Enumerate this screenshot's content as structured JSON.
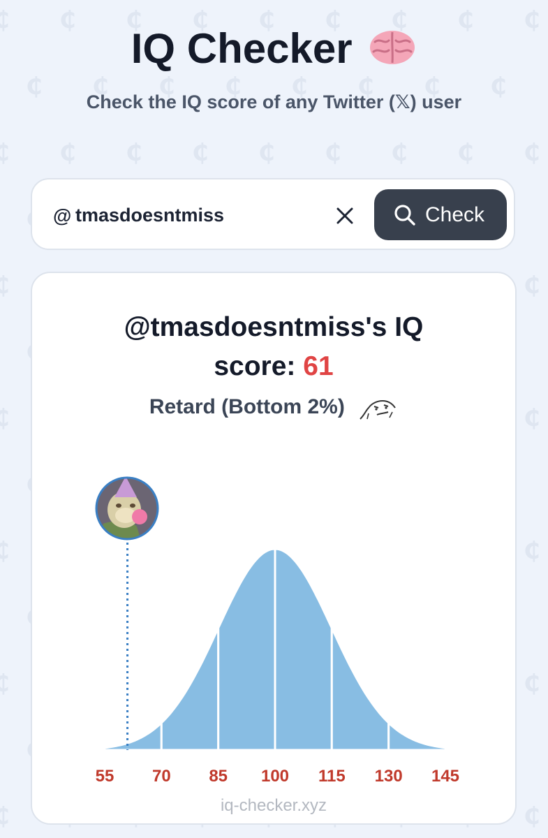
{
  "header": {
    "title": "IQ Checker",
    "brain_icon": "brain-emoji",
    "subtitle": "Check the IQ score of any Twitter (𝕏) user"
  },
  "search": {
    "at_sign": "@",
    "value": "tmasdoesntmiss",
    "clear_icon": "close-icon",
    "button_icon": "search-icon",
    "button_label": "Check"
  },
  "result": {
    "heading_line1": "@tmasdoesntmiss's IQ",
    "heading_line2_prefix": "score: ",
    "score": "61",
    "category": "Retard (Bottom 2%)",
    "category_icon": "wojak-meme-icon",
    "avatar": "bored-ape-avatar",
    "footer": "iq-checker.xyz"
  },
  "colors": {
    "page_bg": "#eef3fb",
    "curve_fill": "#88bde3",
    "tick_label": "#c0392b",
    "score_red": "#e04444",
    "button_bg": "#38404d",
    "marker_line": "#3a7fc4"
  },
  "chart_data": {
    "type": "area",
    "distribution": "normal",
    "mean": 100,
    "sd": 15,
    "x_ticks": [
      55,
      70,
      85,
      100,
      115,
      130,
      145
    ],
    "xlim": [
      55,
      145
    ],
    "bands": [
      [
        55,
        70
      ],
      [
        70,
        85
      ],
      [
        85,
        100
      ],
      [
        100,
        115
      ],
      [
        115,
        130
      ],
      [
        130,
        145
      ]
    ],
    "marker_value": 61,
    "grid": false
  }
}
